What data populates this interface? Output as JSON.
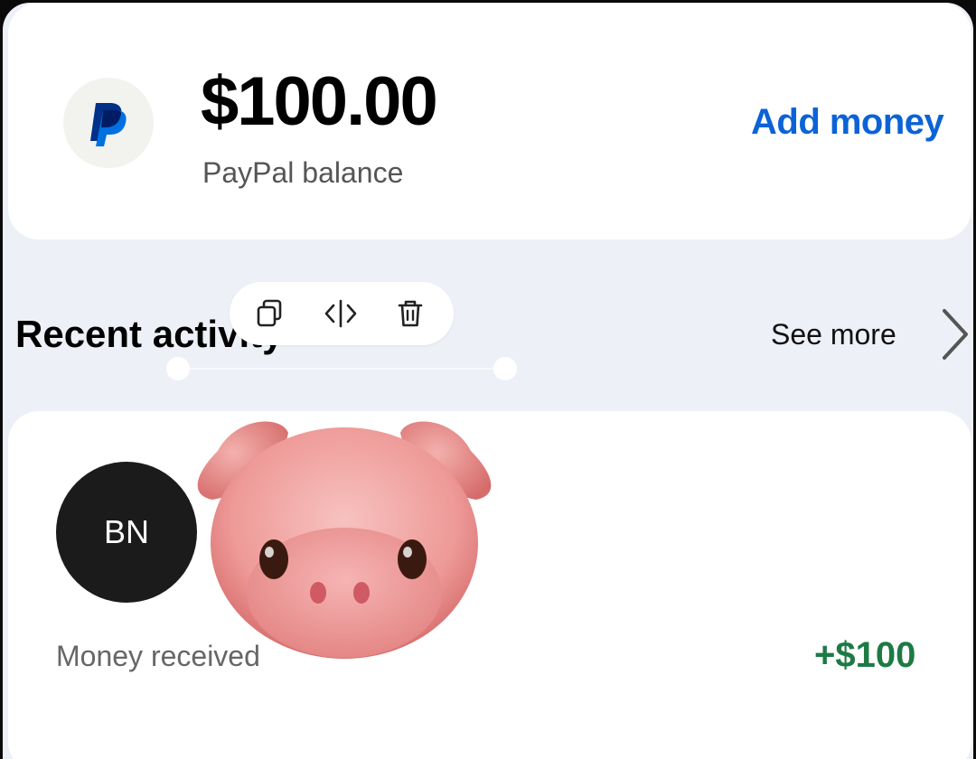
{
  "balance": {
    "logo_icon": "paypal-logo-icon",
    "amount": "$100.00",
    "label": "PayPal balance",
    "add_money_label": "Add money"
  },
  "recent_activity": {
    "title": "Recent activity",
    "see_more_label": "See more",
    "items": [
      {
        "avatar_initials": "BN",
        "description": "Money received",
        "amount": "+$100"
      }
    ]
  },
  "edit_toolbar": {
    "icons": [
      "copy-icon",
      "code-icon",
      "trash-icon"
    ]
  },
  "sticker": "pig-face-emoji",
  "colors": {
    "accent": "#0b63d6",
    "positive": "#1d7a45",
    "background": "#eef0f8",
    "card": "#ffffff"
  }
}
